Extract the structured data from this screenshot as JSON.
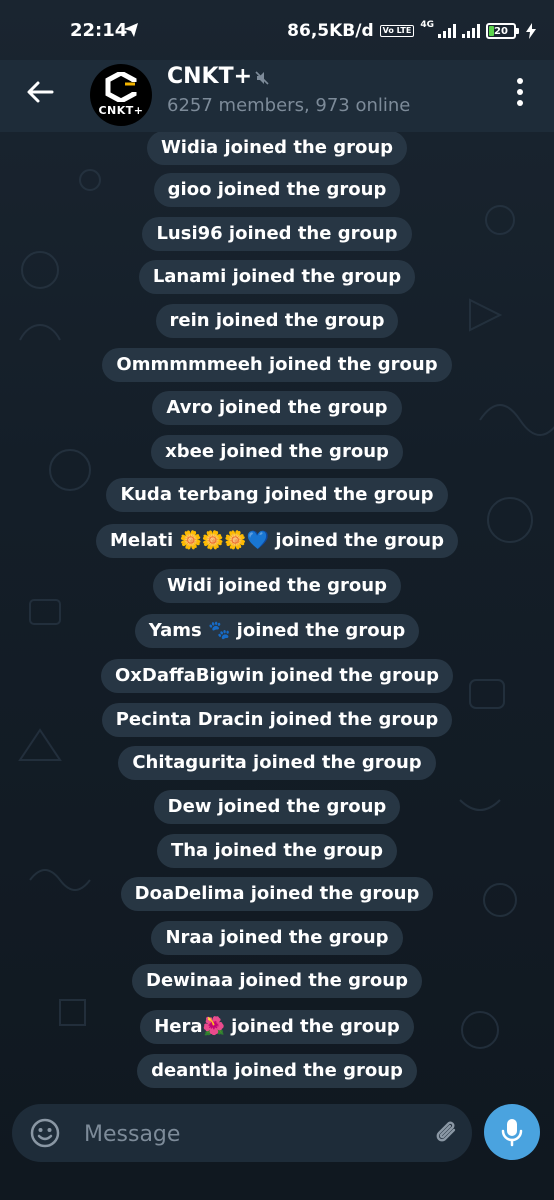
{
  "status_bar": {
    "time": "22:14",
    "net_speed": "86,5KB/d",
    "network": "4G",
    "volte": "Vo LTE",
    "battery": "20",
    "battery_level": 0.2
  },
  "header": {
    "title": "CNKT+",
    "subtitle": "6257 members, 973 online",
    "avatar_text": "CNKT+"
  },
  "messages": [
    {
      "user": "Widia",
      "text": "Widia joined the group"
    },
    {
      "user": "gioo",
      "text": "gioo joined the group"
    },
    {
      "user": "Lusi96",
      "text": "Lusi96 joined the group"
    },
    {
      "user": "Lanami",
      "text": "Lanami joined the group"
    },
    {
      "user": "rein",
      "text": "rein joined the group"
    },
    {
      "user": "Ommmmmeeh",
      "text": "Ommmmmeeh joined the group"
    },
    {
      "user": "Avro",
      "text": "Avro joined the group"
    },
    {
      "user": "xbee",
      "text": "xbee joined the group"
    },
    {
      "user": "Kuda terbang",
      "text": "Kuda terbang joined the group"
    },
    {
      "user": "Melati 🌼🌼🌼💙",
      "text": "Melati 🌼🌼🌼💙 joined the group"
    },
    {
      "user": "Widi",
      "text": "Widi joined the group"
    },
    {
      "user": "Yams 🐾",
      "text": "Yams 🐾 joined the group"
    },
    {
      "user": "OxDaffaBigwin",
      "text": "OxDaffaBigwin joined the group"
    },
    {
      "user": "Pecinta Dracin",
      "text": "Pecinta Dracin joined the group"
    },
    {
      "user": "Chitagurita",
      "text": "Chitagurita joined the group"
    },
    {
      "user": "Dew",
      "text": "Dew joined the group"
    },
    {
      "user": "Tha",
      "text": "Tha joined the group"
    },
    {
      "user": "DoaDelima",
      "text": "DoaDelima joined the group"
    },
    {
      "user": "Nraa",
      "text": "Nraa joined the group"
    },
    {
      "user": "Dewinaa",
      "text": "Dewinaa joined the group"
    },
    {
      "user": "Hera🌺",
      "text": "Hera🌺 joined the group"
    },
    {
      "user": "deantla",
      "text": "deantla joined the group"
    }
  ],
  "composer": {
    "placeholder": "Message"
  },
  "icons": {
    "back": "arrow-left-icon",
    "mute": "muted-icon",
    "more": "more-vertical-icon",
    "emoji": "emoji-icon",
    "attach": "paperclip-icon",
    "mic": "microphone-icon"
  },
  "colors": {
    "background": "#0f1923",
    "header": "#1e2c39",
    "pill": "#293847",
    "subtitle": "#7d8b99",
    "mic_button": "#4aa3df",
    "battery": "#5cd34c"
  }
}
